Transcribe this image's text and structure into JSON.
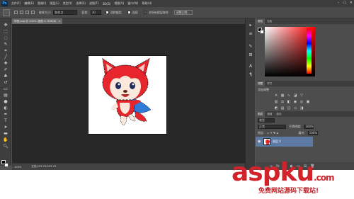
{
  "app": {
    "logo": "Ps",
    "menu": [
      "文件(F)",
      "编辑(E)",
      "图像(I)",
      "图层(L)",
      "类型(Y)",
      "选择(S)",
      "滤镜(T)",
      "3D(D)",
      "视图(V)",
      "窗口(W)",
      "帮助(H)"
    ],
    "window_controls": {
      "minimize": "–",
      "maximize": "□",
      "close": "✕"
    }
  },
  "options_bar": {
    "tool_icon": "quick-selection-icon",
    "size_label": "大小:",
    "size_value": "30",
    "sample_label": "取样大小:",
    "sample_value": "取样点",
    "tolerance_label": "容差:",
    "tolerance_value": "30",
    "antialias_label": "消除锯齿",
    "contiguous_label": "连续",
    "all_layers_label": "对所有图层取样",
    "refine_edge_label": "调整边缘..."
  },
  "document": {
    "tab_label": "阿狸.png @ 100% (图层 0, RGB/8)",
    "tab_close": "×",
    "zoom": "100%",
    "doc_info": "文档:293.7K/293.7K"
  },
  "panels": {
    "color_tabs": [
      "颜色",
      "色板"
    ],
    "adjust_tabs": [
      "调整",
      "样式"
    ],
    "adjust_title": "添加调整",
    "layer_tabs": [
      "图层",
      "通道",
      "路径"
    ],
    "kind_label": "类型",
    "blend_mode": "正常",
    "opacity_label": "不透明度:",
    "opacity_value": "100%",
    "lock_label": "锁定:",
    "fill_label": "填充:",
    "fill_value": "100%",
    "layer_name": "图层 0"
  },
  "watermark": {
    "text": "aspku",
    "suffix": ".com",
    "sub": "免费网站源码下载站!"
  },
  "colors": {
    "canvas_bg": "#282828",
    "layer_selected": "#5d7aa5",
    "fox_red": "#e8242c",
    "watermark_red": "#d2232a"
  }
}
